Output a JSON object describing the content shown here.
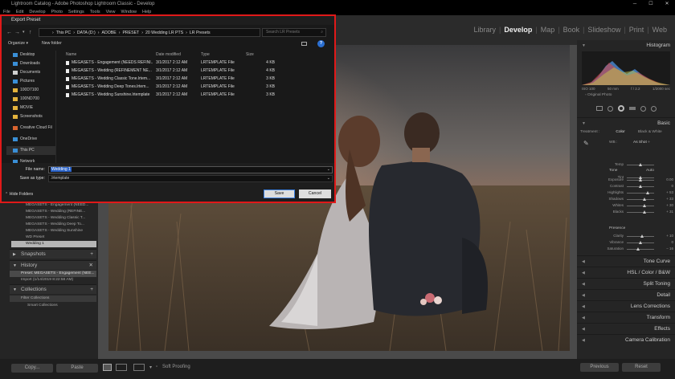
{
  "window": {
    "title": "Lightroom Catalog - Adobe Photoshop Lightroom Classic - Develop"
  },
  "menu": [
    "File",
    "Edit",
    "Develop",
    "Photo",
    "Settings",
    "Tools",
    "View",
    "Window",
    "Help"
  ],
  "modules": [
    {
      "label": "Library",
      "active": false
    },
    {
      "label": "Develop",
      "active": true
    },
    {
      "label": "Map",
      "active": false
    },
    {
      "label": "Book",
      "active": false
    },
    {
      "label": "Slideshow",
      "active": false
    },
    {
      "label": "Print",
      "active": false
    },
    {
      "label": "Web",
      "active": false
    }
  ],
  "dialog": {
    "title": "Export Preset",
    "path": [
      "This PC",
      "DATA (D:)",
      "ADOBE",
      "PRESET",
      "20 Wedding LR PTS",
      "LR Presets"
    ],
    "search_placeholder": "Search LR Presets",
    "organize": "Organize ▾",
    "new_folder": "New folder",
    "nav_items": [
      {
        "label": "Desktop",
        "icon": "desktop-icon",
        "color": "#3a8fd6"
      },
      {
        "label": "Downloads",
        "icon": "download-icon",
        "color": "#3a8fd6"
      },
      {
        "label": "Documents",
        "icon": "documents-icon",
        "color": "#cfcfcf"
      },
      {
        "label": "Pictures",
        "icon": "pictures-icon",
        "color": "#3a8fd6"
      },
      {
        "label": "100D7100",
        "icon": "folder-icon",
        "color": "#e3b23c"
      },
      {
        "label": "100ND700",
        "icon": "folder-icon",
        "color": "#e3b23c"
      },
      {
        "label": "MOVIE",
        "icon": "folder-icon",
        "color": "#e3b23c"
      },
      {
        "label": "Screenshots",
        "icon": "folder-icon",
        "color": "#e3b23c"
      },
      {
        "label": "Creative Cloud Fil",
        "icon": "cloud-icon",
        "color": "#d9632f"
      },
      {
        "label": "OneDrive",
        "icon": "onedrive-icon",
        "color": "#3a8fd6"
      },
      {
        "label": "This PC",
        "icon": "computer-icon",
        "color": "#3a8fd6"
      },
      {
        "label": "Network",
        "icon": "network-icon",
        "color": "#3a8fd6"
      }
    ],
    "columns": {
      "name": "Name",
      "date": "Date modified",
      "type": "Type",
      "size": "Size"
    },
    "files": [
      {
        "name": "MEGASETS - Engagement (NEEDS REFINI...",
        "date": "3/1/2017 2:12 AM",
        "type": "LRTEMPLATE File",
        "size": "4 KB"
      },
      {
        "name": "MEGASETS - Wedding (REFINEMENT NE...",
        "date": "3/1/2017 2:12 AM",
        "type": "LRTEMPLATE File",
        "size": "4 KB"
      },
      {
        "name": "MEGASETS - Wedding Classic Tone.lrtem...",
        "date": "3/1/2017 2:12 AM",
        "type": "LRTEMPLATE File",
        "size": "3 KB"
      },
      {
        "name": "MEGASETS - Wedding Deep Tones.lrtem...",
        "date": "3/1/2017 2:12 AM",
        "type": "LRTEMPLATE File",
        "size": "3 KB"
      },
      {
        "name": "MEGASETS - Wedding Sunshine.lrtemplate",
        "date": "3/1/2017 2:12 AM",
        "type": "LRTEMPLATE File",
        "size": "3 KB"
      }
    ],
    "file_name_label": "File name:",
    "file_name": "Wedding 1",
    "save_type_label": "Save as type:",
    "save_type": ".lrtemplate",
    "hide_folders": "Hide Folders",
    "save": "Save",
    "cancel": "Cancel"
  },
  "left": {
    "presets": [
      "MEGASETS - Engagement (NEED...",
      "MEGASETS - Wedding (REFINE...",
      "MEGASETS - Wedding Classic T...",
      "MEGASETS - Wedding Deep To...",
      "MEGASETS - Wedding Sunshine",
      "WD Preset",
      "Wedding 1"
    ],
    "snapshots": "Snapshots",
    "history": "History",
    "history_items": [
      "Preset: MEGASETS - Engagement (NEE...",
      "Import (1/14/2019 8:22:58 AM)"
    ],
    "collections": "Collections",
    "filter_collections": "Filter Collections",
    "smart_collections": "Smart Collections",
    "copy": "Copy...",
    "paste": "Paste"
  },
  "right": {
    "histogram": "Histogram",
    "hist_info": [
      "ISO 100",
      "50 mm",
      "f / 2.2",
      "1/2000 sec"
    ],
    "original_photo": "Original Photo",
    "basic": "Basic",
    "treatment": "Treatment :",
    "color": "Color",
    "bw": "Black & White",
    "wb_label": "WB :",
    "wb_value": "As Shot ÷",
    "temp": "Temp",
    "tint": "Tint",
    "tone": "Tone",
    "auto": "Auto",
    "tone_sliders": [
      {
        "label": "Exposure",
        "value": "0.00",
        "pos": 0.5
      },
      {
        "label": "Contrast",
        "value": "0",
        "pos": 0.5
      },
      {
        "label": "Highlights",
        "value": "+ 53",
        "pos": 0.76
      },
      {
        "label": "Shadows",
        "value": "+ 33",
        "pos": 0.66
      },
      {
        "label": "Whites",
        "value": "+ 30",
        "pos": 0.65
      },
      {
        "label": "Blacks",
        "value": "+ 31",
        "pos": 0.65
      }
    ],
    "presence": "Presence",
    "presence_sliders": [
      {
        "label": "Clarity",
        "value": "+ 10",
        "pos": 0.55
      },
      {
        "label": "Vibrance",
        "value": "0",
        "pos": 0.5
      },
      {
        "label": "Saturation",
        "value": "− 16",
        "pos": 0.42
      }
    ],
    "panels": [
      "Tone Curve",
      "HSL / Color / B&W",
      "Split Toning",
      "Detail",
      "Lens Corrections",
      "Transform",
      "Effects",
      "Camera Calibration"
    ],
    "previous": "Previous",
    "reset": "Reset"
  },
  "toolbar": {
    "soft_proofing": "Soft Proofing"
  }
}
